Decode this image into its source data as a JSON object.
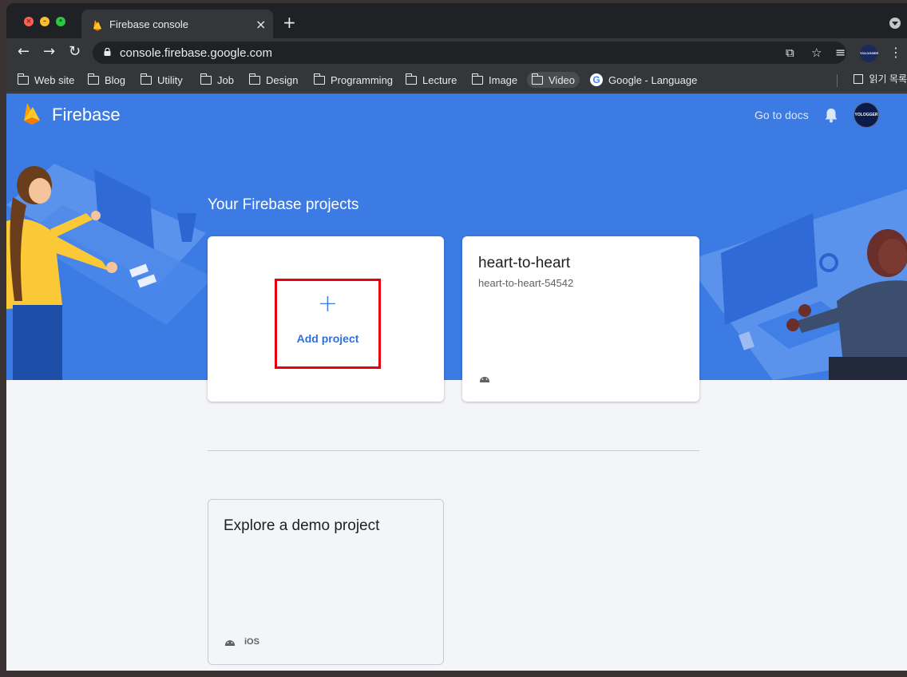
{
  "browser": {
    "tab_title": "Firebase console",
    "tab_close": "×",
    "new_tab": "+",
    "url": "console.firebase.google.com",
    "profile_text": "YOLOGGER",
    "bookmarks": [
      {
        "label": "Web site",
        "type": "folder"
      },
      {
        "label": "Blog",
        "type": "folder"
      },
      {
        "label": "Utility",
        "type": "folder"
      },
      {
        "label": "Job",
        "type": "folder"
      },
      {
        "label": "Design",
        "type": "folder"
      },
      {
        "label": "Programming",
        "type": "folder"
      },
      {
        "label": "Lecture",
        "type": "folder"
      },
      {
        "label": "Image",
        "type": "folder"
      },
      {
        "label": "Video",
        "type": "folder"
      },
      {
        "label": "Google - Language",
        "type": "link"
      }
    ],
    "reading_list": "읽기 목록"
  },
  "header": {
    "brand": "Firebase",
    "docs_link": "Go to docs",
    "avatar_text": "YOLOGGER"
  },
  "main": {
    "section_title": "Your Firebase projects",
    "add_card": {
      "plus": "+",
      "label": "Add project"
    },
    "project_card": {
      "name": "heart-to-heart",
      "id": "heart-to-heart-54542",
      "platform_icon": "android-icon"
    },
    "demo_card": {
      "title": "Explore a demo project",
      "platforms": [
        "android",
        "iOS"
      ],
      "ios_label": "iOS"
    }
  },
  "colors": {
    "hero_blue": "#3b7be3",
    "highlight_red": "#e8000b",
    "chrome_dark": "#202124",
    "chrome_toolbar": "#35363a"
  }
}
